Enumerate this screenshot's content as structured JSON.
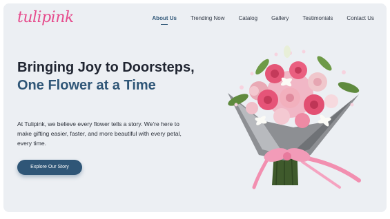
{
  "brand": {
    "logo_text": "tulipink"
  },
  "nav": {
    "items": [
      {
        "label": "About Us",
        "active": true
      },
      {
        "label": "Trending Now",
        "active": false
      },
      {
        "label": "Catalog",
        "active": false
      },
      {
        "label": "Gallery",
        "active": false
      },
      {
        "label": "Testimonials",
        "active": false
      },
      {
        "label": "Contact Us",
        "active": false
      }
    ]
  },
  "hero": {
    "headline_part1": "Bringing Joy to Doorsteps, ",
    "headline_accent": "One Flower at a Time",
    "description": "At Tulipink, we believe every flower tells a story. We're here to make gifting easier, faster, and more beautiful with every petal, every time.",
    "cta_label": "Explore Our Story"
  },
  "colors": {
    "background": "#eceff3",
    "brand_pink": "#e64b8c",
    "accent_blue": "#2f5677",
    "text_dark": "#1f2430"
  },
  "image": {
    "name": "flower-bouquet-image",
    "content": "pink roses bouquet wrapped in grey paper with pink ribbon"
  }
}
